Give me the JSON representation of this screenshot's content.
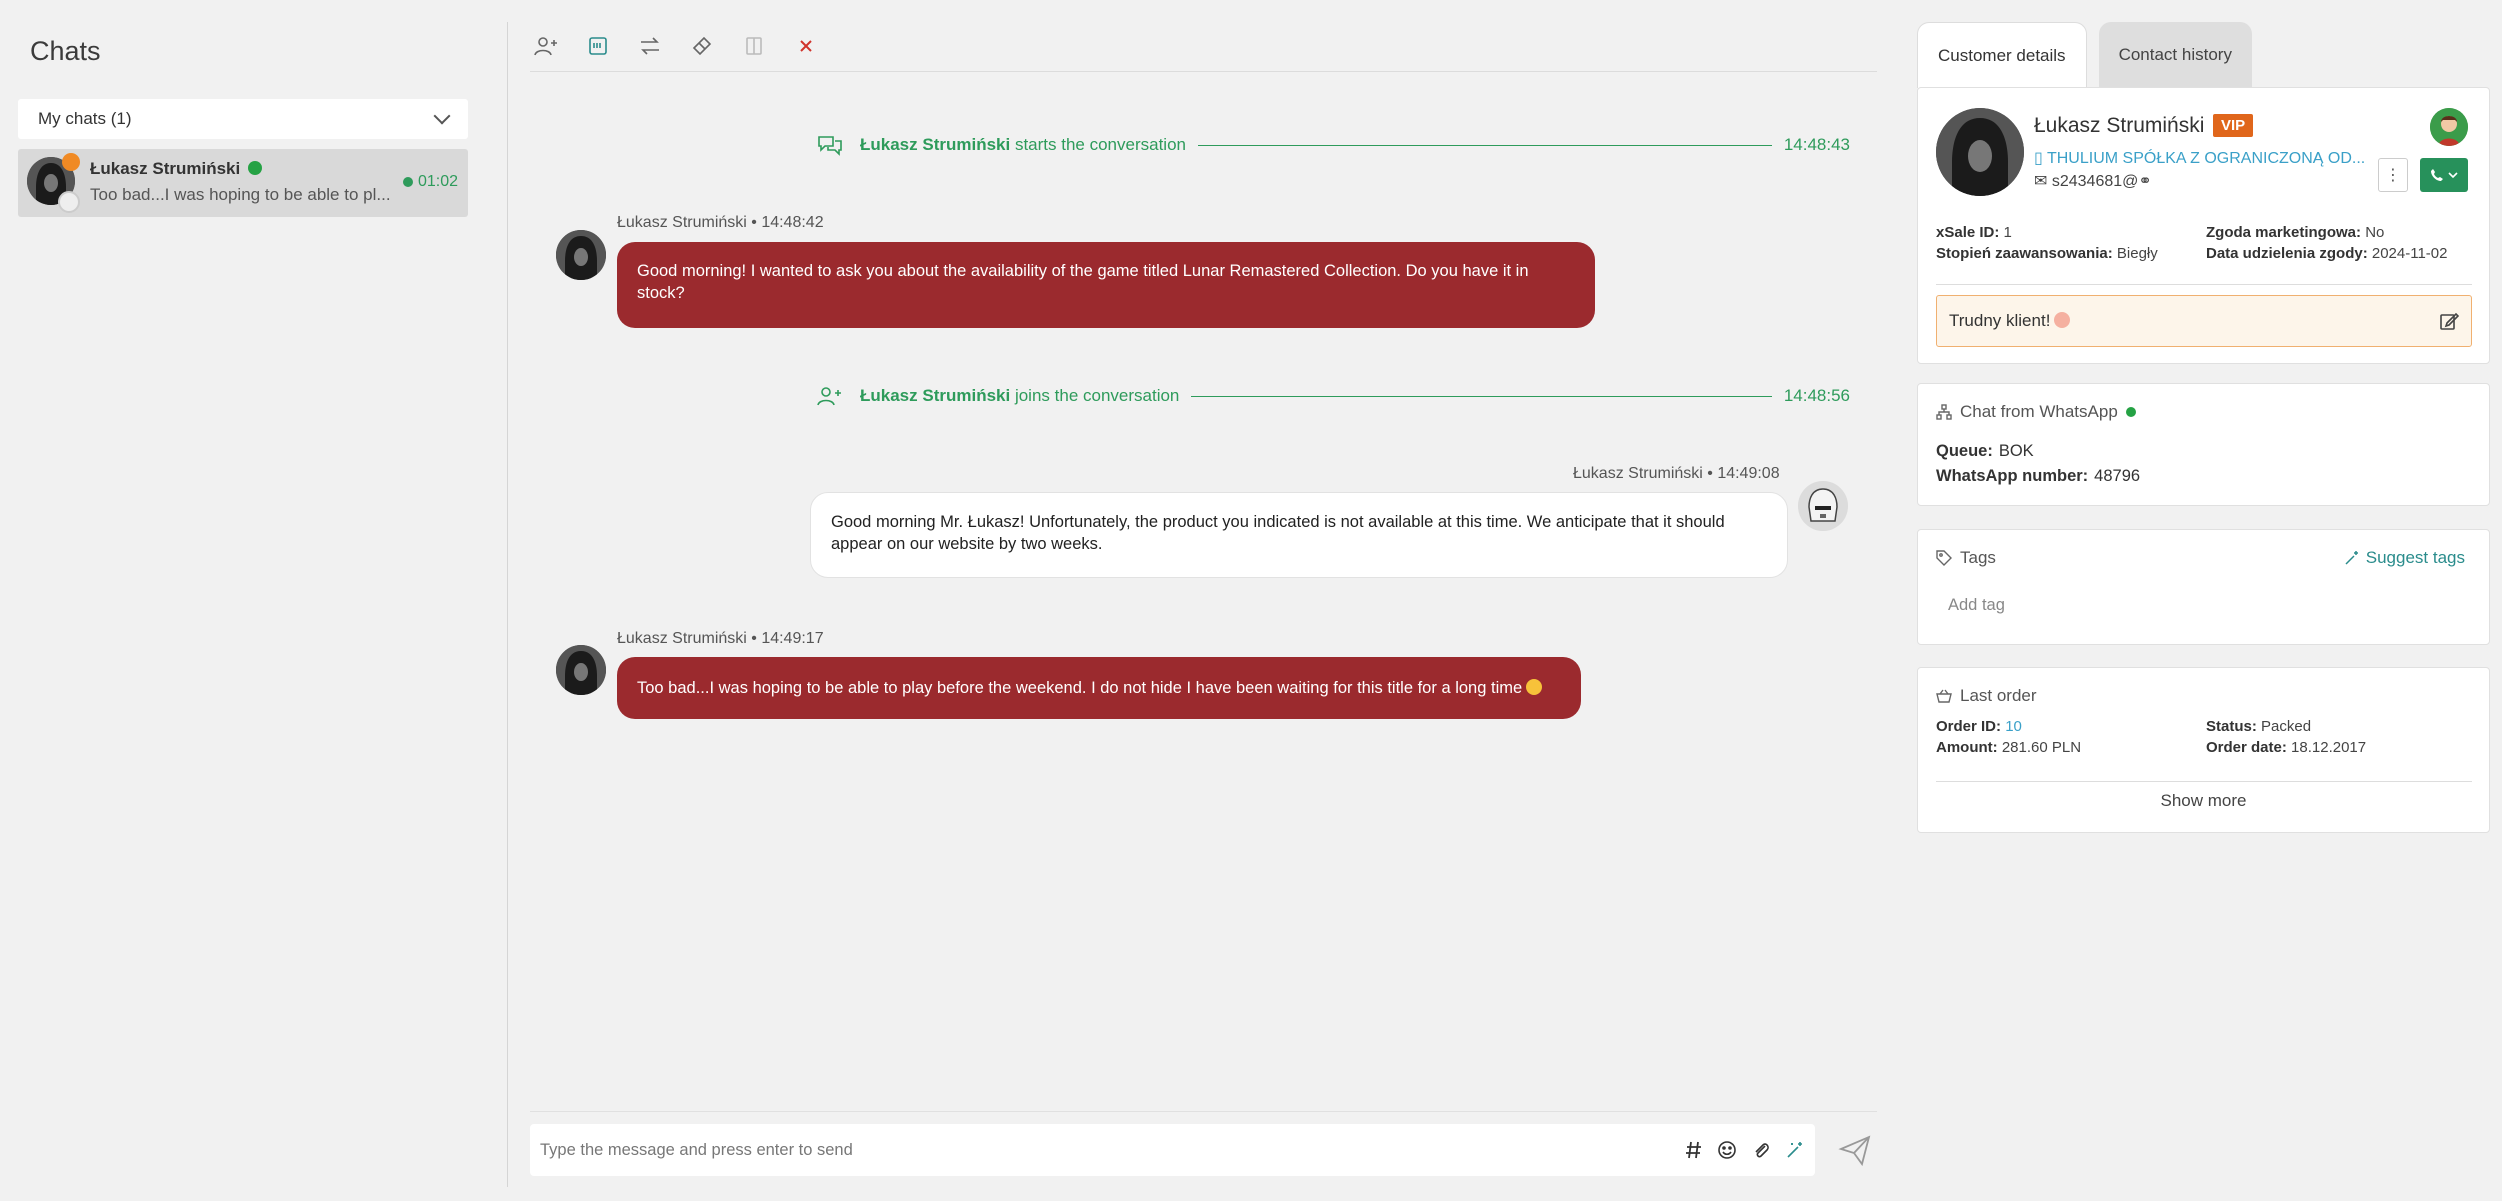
{
  "sidebar": {
    "title": "Chats",
    "group_label": "My chats (1)",
    "chat": {
      "name": "Łukasz Strumiński",
      "preview": "Too bad...I was hoping to be able to pl...",
      "timer": "01:02"
    }
  },
  "events": {
    "start": {
      "name": "Łukasz Strumiński",
      "text": "starts the conversation",
      "time": "14:48:43"
    },
    "join": {
      "name": "Łukasz Strumiński",
      "text": "joins the conversation",
      "time": "14:48:56"
    }
  },
  "messages": [
    {
      "meta": "Łukasz Strumiński • 14:48:42",
      "text": "Good morning! I wanted to ask you about the availability of the game titled Lunar Remastered Collection. Do you have it in stock?"
    },
    {
      "meta": "Łukasz Strumiński • 14:49:08",
      "text": "Good morning Mr. Łukasz! Unfortunately, the product you indicated is not available at this time. We anticipate that it should appear on our website by two weeks."
    },
    {
      "meta": "Łukasz Strumiński • 14:49:17",
      "text": "Too bad...I was hoping to be able to play before the weekend. I do not hide I have been waiting for this title for a long time"
    }
  ],
  "composer": {
    "placeholder": "Type the message and press enter to send"
  },
  "right": {
    "tabs": [
      "Customer details",
      "Contact history"
    ],
    "customer": {
      "name": "Łukasz Strumiński",
      "vip": "VIP",
      "company": "THULIUM SPÓŁKA Z OGRANICZONĄ OD...",
      "contact": "s2434681@",
      "xsale_label": "xSale ID:",
      "xsale": "1",
      "zgoda_label": "Zgoda marketingowa:",
      "zgoda": "No",
      "stopien_label": "Stopień zaawansowania:",
      "stopien": "Biegły",
      "data_label": "Data udzielenia zgody:",
      "data": "2024-11-02",
      "note": "Trudny klient!"
    },
    "channel": {
      "title": "Chat from WhatsApp",
      "queue_label": "Queue:",
      "queue": "BOK",
      "number_label": "WhatsApp number:",
      "number": "48796"
    },
    "tags": {
      "title": "Tags",
      "suggest": "Suggest tags",
      "add": "Add tag"
    },
    "order": {
      "title": "Last order",
      "id_label": "Order ID:",
      "id": "10",
      "status_label": "Status:",
      "status": "Packed",
      "amount_label": "Amount:",
      "amount": "281.60 PLN",
      "date_label": "Order date:",
      "date": "18.12.2017",
      "show_more": "Show more"
    }
  }
}
